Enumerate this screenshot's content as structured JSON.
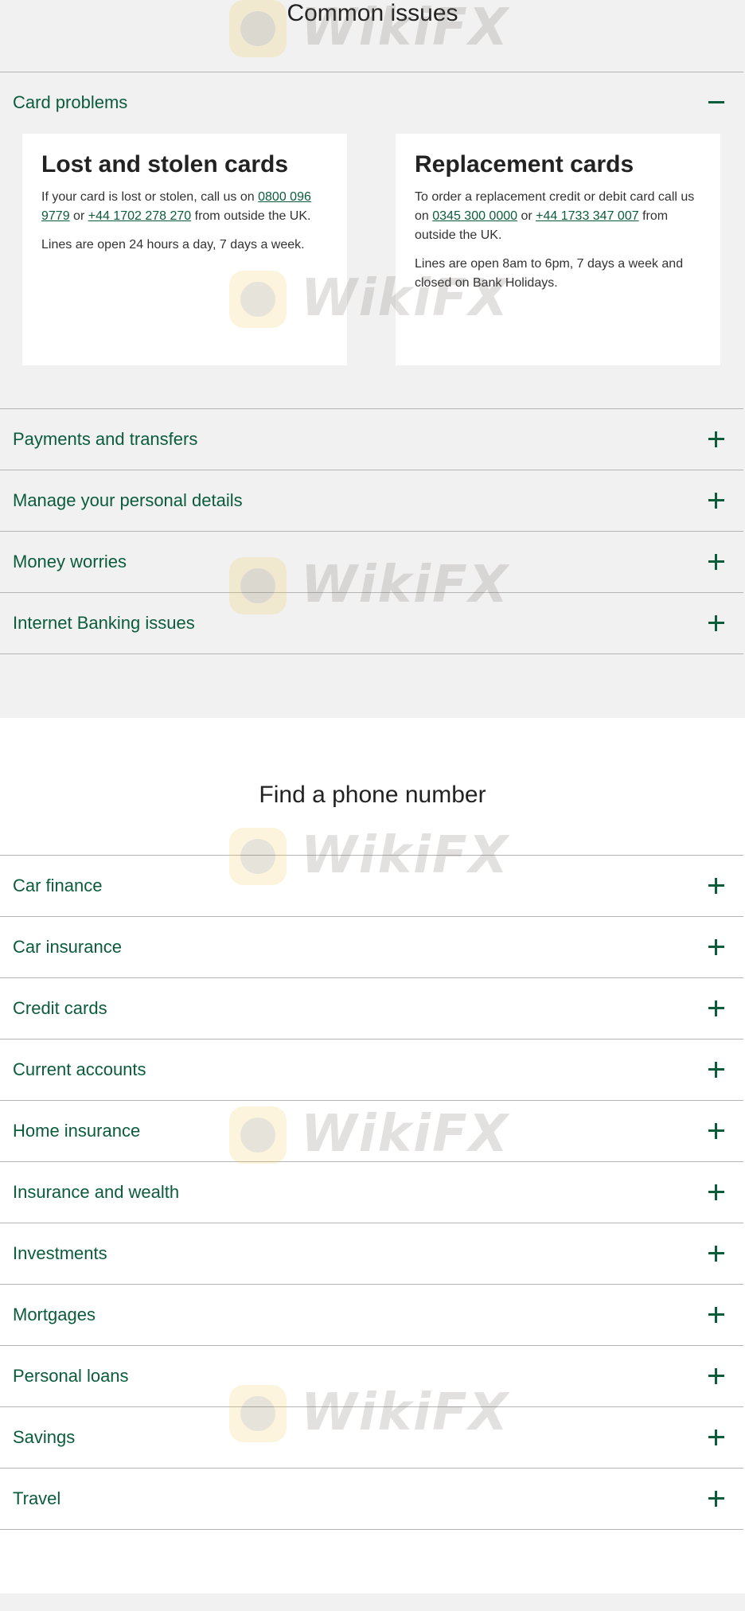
{
  "common_issues": {
    "title": "Common issues",
    "expanded_item": "Card problems",
    "cards": [
      {
        "title": "Lost and stolen cards",
        "text_before": "If your card is lost or stolen, call us on ",
        "phone1": "0800 096 9779",
        "text_mid": " or ",
        "phone2": "+44 1702 278 270",
        "text_after": " from outside the UK.",
        "hours": "Lines are open 24 hours a day, 7 days a week."
      },
      {
        "title": "Replacement cards",
        "text_before": "To order a replacement credit or debit card call us on ",
        "phone1": "0345 300 0000",
        "text_mid": " or ",
        "phone2": "+44 1733 347 007",
        "text_after": " from outside the UK.",
        "hours": "Lines are open 8am to 6pm, 7 days a week and closed on Bank Holidays."
      }
    ],
    "items": [
      "Card problems",
      "Payments and transfers",
      "Manage your personal details",
      "Money worries",
      "Internet Banking issues"
    ]
  },
  "find_phone": {
    "title": "Find a phone number",
    "items": [
      "Car finance",
      "Car insurance",
      "Credit cards",
      "Current accounts",
      "Home insurance",
      "Insurance and wealth",
      "Investments",
      "Mortgages",
      "Personal loans",
      "Savings",
      "Travel"
    ]
  },
  "watermark": {
    "text": "WikiFX"
  },
  "colors": {
    "accent": "#0b5c3b",
    "section_bg": "#f1f1f1",
    "divider": "#b5b5b5"
  }
}
